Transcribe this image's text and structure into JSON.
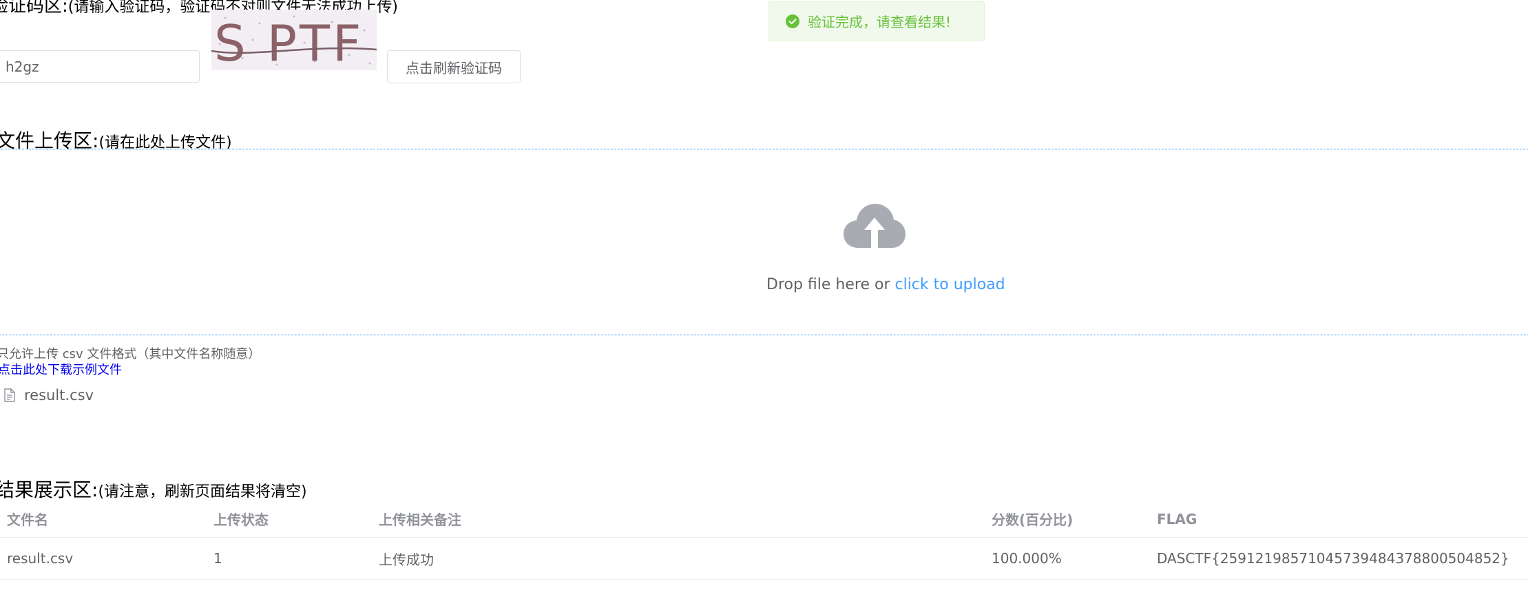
{
  "captcha": {
    "heading": "验证码区:",
    "heading_note": "(请输入验证码，验证码不对则文件无法成功上传)",
    "input_value": "h2gz",
    "image_text": "S PTF",
    "refresh_label": "点击刷新验证码"
  },
  "toast": {
    "icon": "success-check-icon",
    "message": "验证完成，请查看结果!",
    "color": "#67c23a"
  },
  "upload": {
    "heading": "文件上传区:",
    "heading_note": "(请在此处上传文件)",
    "drop_text": "Drop file here or ",
    "drop_link": "click to upload",
    "tip": "只允许上传 csv 文件格式（其中文件名称随意）",
    "download_link": "点击此处下载示例文件",
    "files": [
      {
        "name": "result.csv",
        "icon": "document-icon"
      }
    ],
    "accent": "#409eff"
  },
  "results": {
    "heading": "结果展示区:",
    "heading_note": "(请注意，刷新页面结果将清空)",
    "columns": [
      "文件名",
      "上传状态",
      "上传相关备注",
      "分数(百分比)",
      "FLAG"
    ],
    "rows": [
      [
        "result.csv",
        "1",
        "上传成功",
        "100.000%",
        "DASCTF{25912198571045739484378800504852}"
      ]
    ]
  }
}
